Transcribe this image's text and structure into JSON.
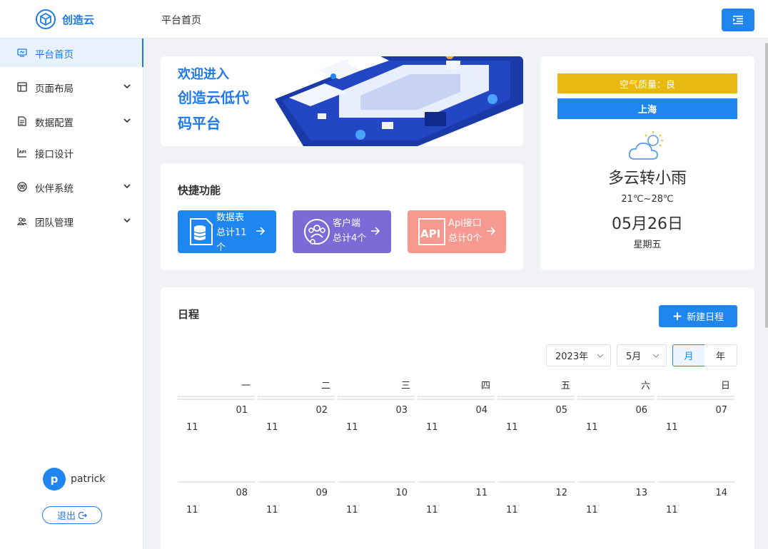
{
  "app": {
    "name": "创造云",
    "page_title": "平台首页"
  },
  "sidebar": {
    "items": [
      {
        "label": "平台首页",
        "icon": "monitor-icon",
        "active": true,
        "expandable": false
      },
      {
        "label": "页面布局",
        "icon": "layout-icon",
        "active": false,
        "expandable": true
      },
      {
        "label": "数据配置",
        "icon": "document-icon",
        "active": false,
        "expandable": true
      },
      {
        "label": "接口设计",
        "icon": "api-icon",
        "active": false,
        "expandable": false
      },
      {
        "label": "伙伴系统",
        "icon": "partner-icon",
        "active": false,
        "expandable": true
      },
      {
        "label": "团队管理",
        "icon": "team-icon",
        "active": false,
        "expandable": true
      }
    ],
    "user": {
      "initial": "p",
      "name": "patrick"
    },
    "logout_label": "退出"
  },
  "welcome": {
    "line1": "欢迎进入",
    "line2": "创造云低代",
    "line3": "码平台"
  },
  "quick": {
    "title": "快捷功能",
    "items": [
      {
        "name": "数据表",
        "count": "总计11个",
        "icon": "database-icon",
        "color": "#1f86f0"
      },
      {
        "name": "客户端",
        "count": "总计4个",
        "icon": "client-icon",
        "color": "#7b6bd6"
      },
      {
        "name": "Api接口",
        "count": "总计0个",
        "icon": "api-icon",
        "color": "#f69a91"
      }
    ]
  },
  "weather": {
    "air_quality": "空气质量：良",
    "city": "上海",
    "icon": "partly-cloudy-icon",
    "condition": "多云转小雨",
    "temperature": "21℃~28℃",
    "date": "05月26日",
    "weekday": "星期五"
  },
  "schedule": {
    "title": "日程",
    "new_button": "新建日程",
    "year_select": "2023年",
    "month_select": "5月",
    "view_month": "月",
    "view_year": "年",
    "weekdays": [
      "一",
      "二",
      "三",
      "四",
      "五",
      "六",
      "日"
    ],
    "weeks": [
      [
        {
          "day": "01",
          "lunar": "11"
        },
        {
          "day": "02",
          "lunar": "11"
        },
        {
          "day": "03",
          "lunar": "11"
        },
        {
          "day": "04",
          "lunar": "11"
        },
        {
          "day": "05",
          "lunar": "11"
        },
        {
          "day": "06",
          "lunar": "11"
        },
        {
          "day": "07",
          "lunar": "11"
        }
      ],
      [
        {
          "day": "08",
          "lunar": "11"
        },
        {
          "day": "09",
          "lunar": "11"
        },
        {
          "day": "10",
          "lunar": "11"
        },
        {
          "day": "11",
          "lunar": "11"
        },
        {
          "day": "12",
          "lunar": "11"
        },
        {
          "day": "13",
          "lunar": "11"
        },
        {
          "day": "14",
          "lunar": "11"
        }
      ]
    ]
  },
  "colors": {
    "primary": "#1f86f0",
    "air_quality": "#e8b910",
    "client": "#7b6bd6",
    "api": "#f69a91"
  }
}
